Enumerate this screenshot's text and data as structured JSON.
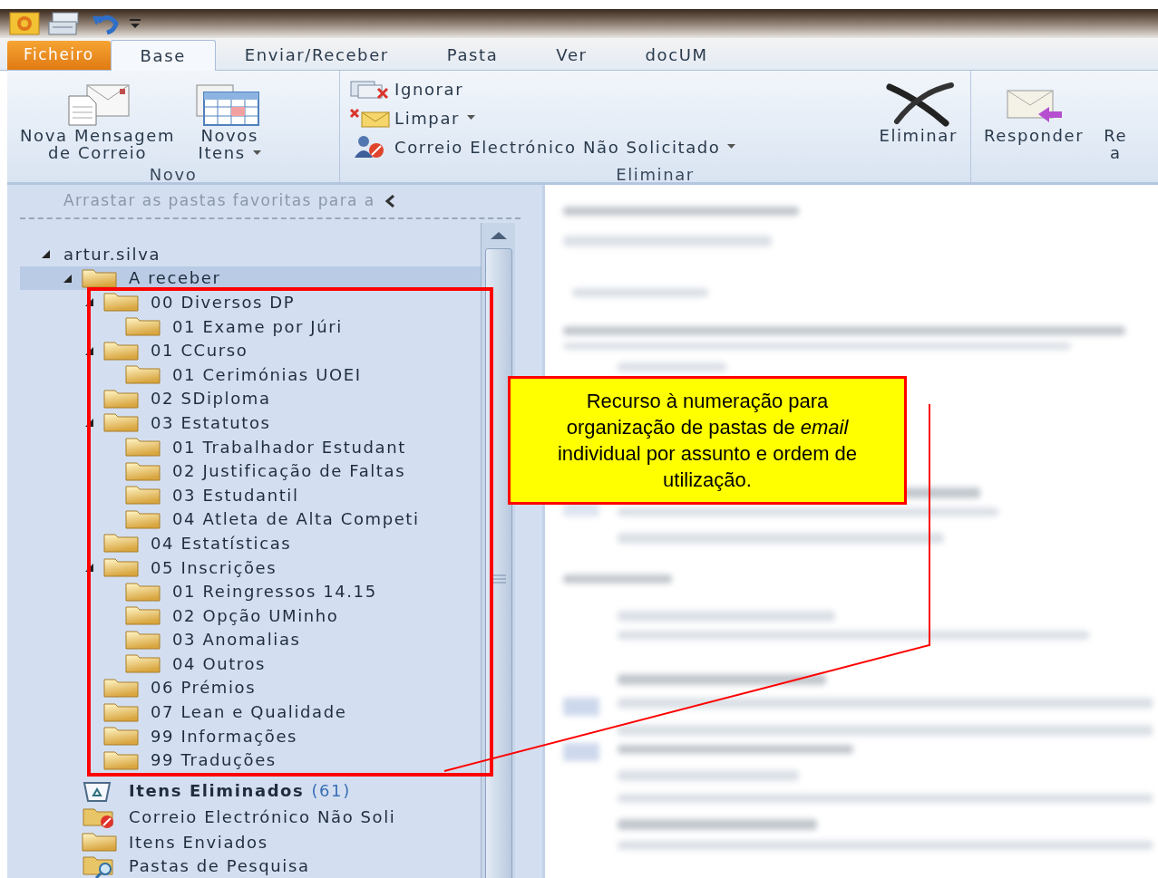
{
  "quick_access": {
    "items": [
      {
        "kind": "logo"
      },
      {
        "kind": "send-receive"
      },
      {
        "kind": "undo"
      },
      {
        "kind": "customize"
      }
    ]
  },
  "tabs": [
    {
      "label": "Ficheiro",
      "kind": "file",
      "selected": false
    },
    {
      "label": "Base",
      "kind": "tab",
      "selected": true
    },
    {
      "label": "Enviar/Receber",
      "kind": "tab",
      "selected": false
    },
    {
      "label": "Pasta",
      "kind": "tab",
      "selected": false
    },
    {
      "label": "Ver",
      "kind": "tab",
      "selected": false
    },
    {
      "label": "docUM",
      "kind": "tab",
      "selected": false
    }
  ],
  "ribbon": {
    "groups": [
      {
        "title": "Novo",
        "buttons": [
          {
            "kind": "large",
            "lines": [
              "Nova Mensagem",
              "de Correio"
            ],
            "dropdown": false
          },
          {
            "kind": "large",
            "lines": [
              "Novos",
              "Itens"
            ],
            "dropdown": true
          }
        ]
      },
      {
        "title": "Eliminar",
        "buttons": [
          {
            "kind": "small",
            "lines": [
              "Ignorar"
            ],
            "dropdown": false
          },
          {
            "kind": "small",
            "lines": [
              "Limpar"
            ],
            "dropdown": true
          },
          {
            "kind": "small",
            "lines": [
              "Correio Electrónico Não Solicitado"
            ],
            "dropdown": true
          },
          {
            "kind": "large",
            "lines": [
              "Eliminar"
            ],
            "dropdown": false
          }
        ]
      },
      {
        "buttons": [
          {
            "kind": "large",
            "lines": [
              "Responder"
            ],
            "dropdown": false
          },
          {
            "kind": "large",
            "lines": [
              "Re",
              "a"
            ],
            "dropdown": false
          }
        ]
      }
    ]
  },
  "navigation": {
    "favorites_hint": "Arrastar as pastas favoritas para a",
    "tree": [
      {
        "label": "artur.silva",
        "kind": "account",
        "selected": false,
        "expanded": true,
        "children": [
          {
            "label": "A receber",
            "kind": "folder",
            "selected": true,
            "expanded": true,
            "children": [
              {
                "label": "00 Diversos DP",
                "kind": "folder",
                "selected": false,
                "expanded": true,
                "children": [
                  {
                    "label": "01 Exame por Júri",
                    "kind": "folder",
                    "selected": false
                  }
                ]
              },
              {
                "label": "01 CCurso",
                "kind": "folder",
                "selected": false,
                "expanded": true,
                "children": [
                  {
                    "label": "01 Cerimónias UOEI",
                    "kind": "folder",
                    "selected": false
                  }
                ]
              },
              {
                "label": "02 SDiploma",
                "kind": "folder",
                "selected": false
              },
              {
                "label": "03 Estatutos",
                "kind": "folder",
                "selected": false,
                "expanded": true,
                "children": [
                  {
                    "label": "01 Trabalhador Estudant",
                    "kind": "folder",
                    "selected": false
                  },
                  {
                    "label": "02 Justificação de Faltas",
                    "kind": "folder",
                    "selected": false
                  },
                  {
                    "label": "03 Estudantil",
                    "kind": "folder",
                    "selected": false
                  },
                  {
                    "label": "04 Atleta de Alta Competi",
                    "kind": "folder",
                    "selected": false
                  }
                ]
              },
              {
                "label": "04 Estatísticas",
                "kind": "folder",
                "selected": false
              },
              {
                "label": "05 Inscrições",
                "kind": "folder",
                "selected": false,
                "expanded": true,
                "children": [
                  {
                    "label": "01 Reingressos 14.15",
                    "kind": "folder",
                    "selected": false
                  },
                  {
                    "label": "02 Opção UMinho",
                    "kind": "folder",
                    "selected": false
                  },
                  {
                    "label": "03 Anomalias",
                    "kind": "folder",
                    "selected": false
                  },
                  {
                    "label": "04 Outros",
                    "kind": "folder",
                    "selected": false
                  }
                ]
              },
              {
                "label": "06 Prémios",
                "kind": "folder",
                "selected": false
              },
              {
                "label": "07 Lean e Qualidade",
                "kind": "folder",
                "selected": false
              },
              {
                "label": "99 Informações",
                "kind": "folder",
                "selected": false
              },
              {
                "label": "99 Traduções",
                "kind": "folder",
                "selected": false
              }
            ]
          },
          {
            "label": "Itens Eliminados",
            "kind": "deleted",
            "count": "(61)",
            "selected": false
          },
          {
            "label": "Correio Electrónico Não Soli",
            "kind": "junk",
            "selected": false
          },
          {
            "label": "Itens Enviados",
            "kind": "folder",
            "selected": false
          },
          {
            "label": "Pastas de Pesquisa",
            "kind": "search",
            "selected": false
          }
        ]
      }
    ]
  },
  "callout": {
    "text": "Recurso à numeração para organização de pastas de *email* individual por assunto e ordem de utilização."
  }
}
